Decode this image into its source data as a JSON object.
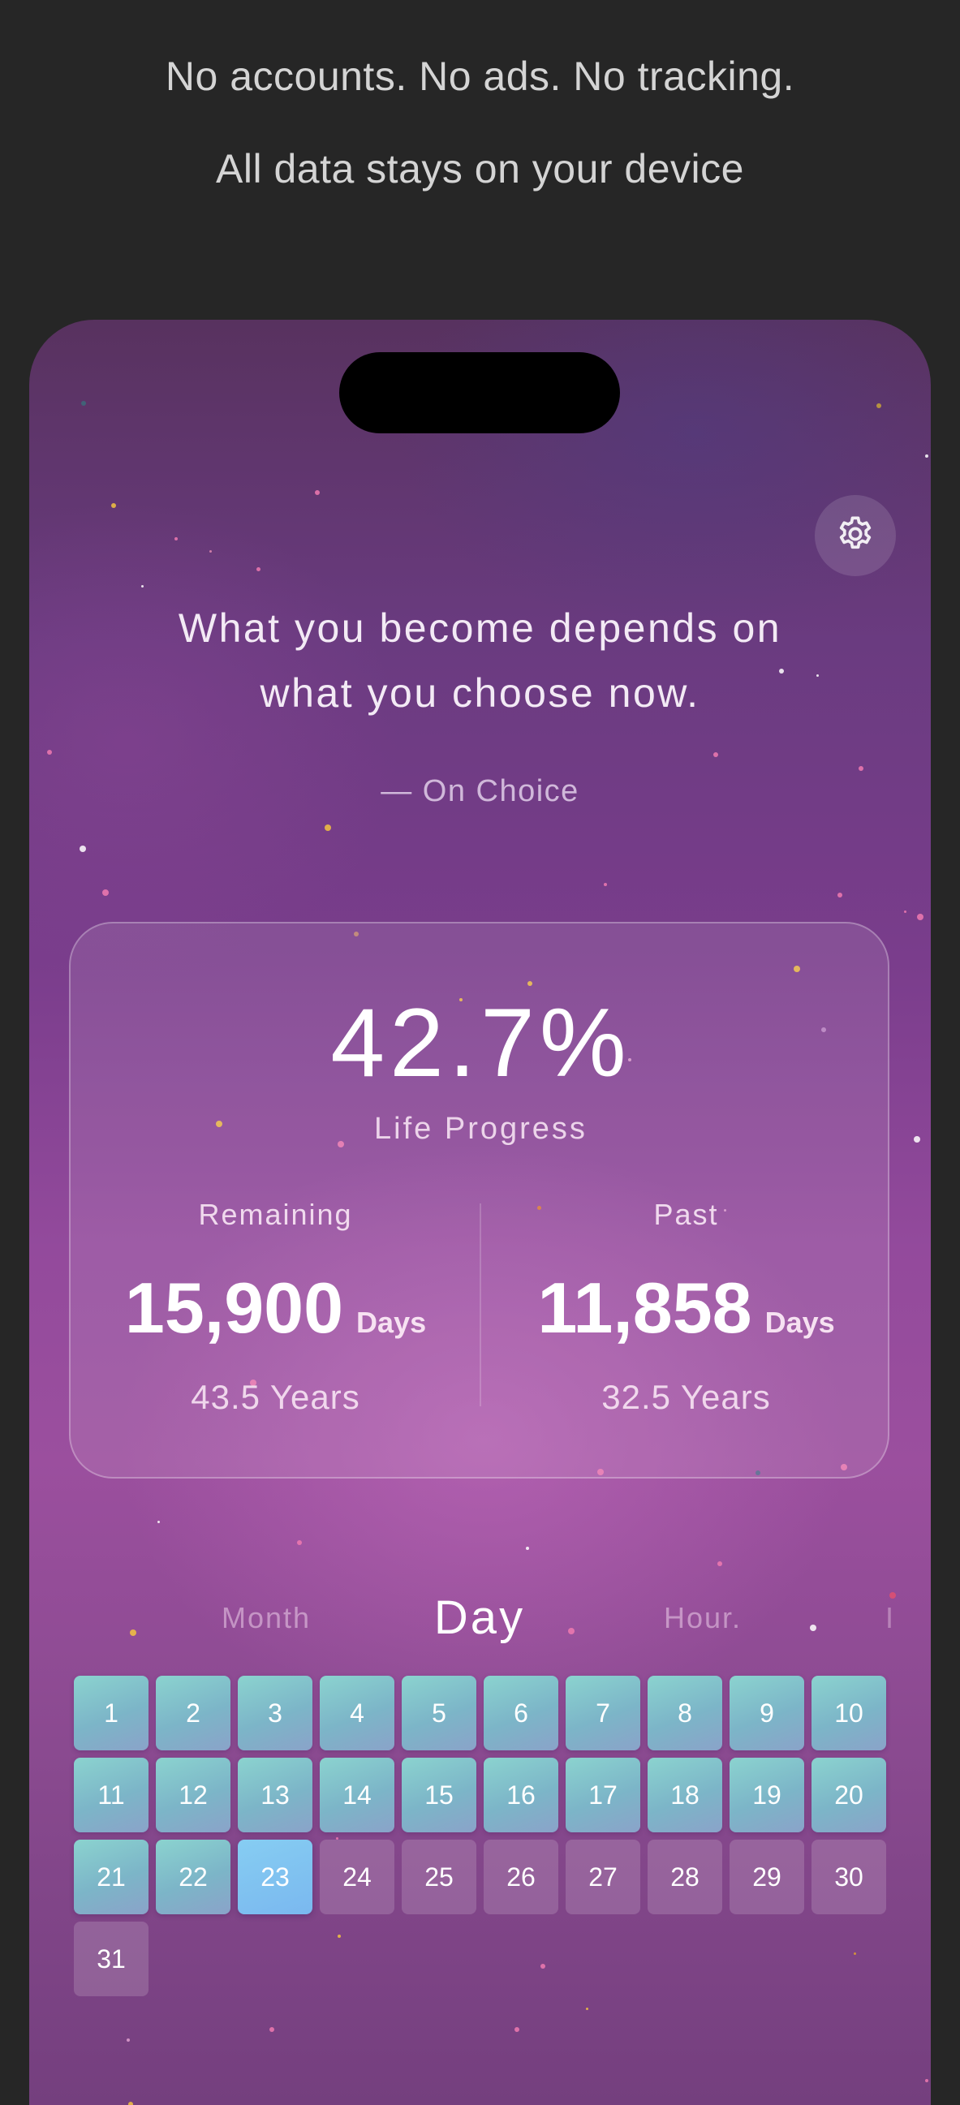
{
  "promo": {
    "line1": "No accounts. No ads. No tracking.",
    "line2": "All data stays on your device"
  },
  "header": {
    "settings_icon": "gear-icon"
  },
  "quote": {
    "line1": "What you become depends on",
    "line2": "what you choose now.",
    "attribution": "— On Choice"
  },
  "progress": {
    "percent_text": "42.7%",
    "label": "Life Progress",
    "remaining": {
      "heading": "Remaining",
      "days": "15,900",
      "days_unit": "Days",
      "years": "43.5 Years"
    },
    "past": {
      "heading": "Past",
      "days": "11,858",
      "days_unit": "Days",
      "years": "32.5 Years"
    }
  },
  "view_tabs": {
    "month": "Month",
    "day": "Day",
    "hour": "Hour.",
    "more": "I",
    "selected": "Day"
  },
  "calendar": {
    "today": 23,
    "days": [
      "1",
      "2",
      "3",
      "4",
      "5",
      "6",
      "7",
      "8",
      "9",
      "10",
      "11",
      "12",
      "13",
      "14",
      "15",
      "16",
      "17",
      "18",
      "19",
      "20",
      "21",
      "22",
      "23",
      "24",
      "25",
      "26",
      "27",
      "28",
      "29",
      "30",
      "31"
    ]
  },
  "colors": {
    "past_day": "#7cb5c8",
    "today": "#7ab8ef",
    "future_day": "rgba(255,255,255,0.16)"
  }
}
